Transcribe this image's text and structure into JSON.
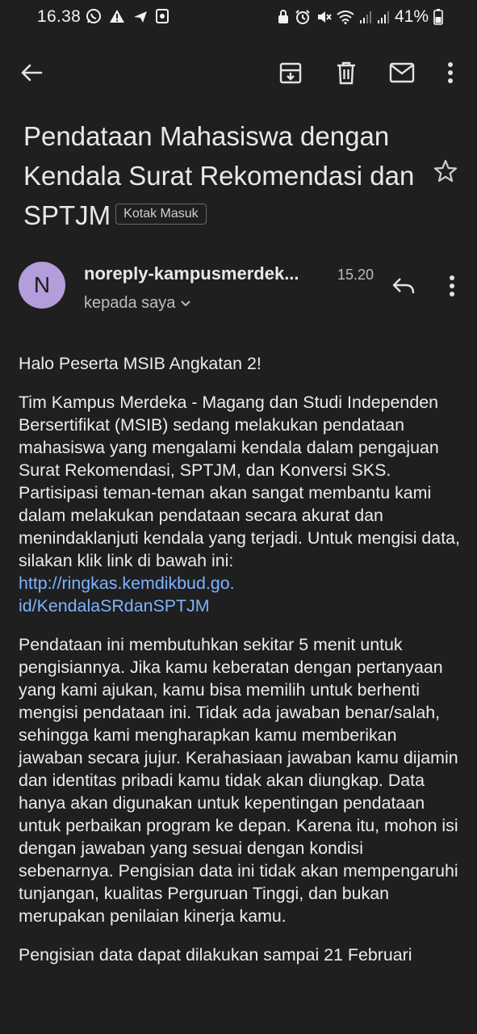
{
  "status_bar": {
    "time": "16.38",
    "battery": "41%",
    "left_icons": [
      "whatsapp-icon",
      "warning-icon",
      "plane-icon",
      "square-notif-icon"
    ],
    "right_icons": [
      "lock-icon",
      "alarm-icon",
      "mute-icon",
      "wifi-icon",
      "signal-icon",
      "signal-icon",
      "battery-icon"
    ]
  },
  "toolbar": {
    "back": "back-arrow-icon",
    "archive": "archive-icon",
    "delete": "trash-icon",
    "mark_unread": "mail-icon",
    "more": "more-vert-icon"
  },
  "email": {
    "subject": "Pendataan Mahasiswa dengan Kendala Surat Rekomendasi dan SPTJM",
    "label": "Kotak Masuk",
    "sender_initial": "N",
    "sender": "noreply-kampusmerdek...",
    "time": "15.20",
    "recipient": "kepada saya",
    "body": {
      "greeting": "Halo Peserta MSIB Angkatan 2!",
      "para1": "Tim Kampus Merdeka - Magang dan Studi Independen Bersertifikat (MSIB) sedang melakukan pendataan mahasiswa yang mengalami kendala dalam pengajuan Surat Rekomendasi, SPTJM, dan Konversi SKS. Partisipasi teman-teman akan sangat membantu kami dalam melakukan pendataan secara akurat dan menindaklanjuti kendala yang terjadi. Untuk mengisi data, silakan klik link di bawah ini:",
      "link_line1": "http://ringkas.kemdikbud.go.",
      "link_line2": "id/KendalaSRdanSPTJM",
      "para2": "Pendataan ini membutuhkan sekitar 5 menit untuk pengisiannya. Jika kamu keberatan dengan pertanyaan yang kami ajukan, kamu bisa memilih untuk berhenti mengisi pendataan ini. Tidak ada jawaban benar/salah, sehingga kami mengharapkan kamu memberikan jawaban secara jujur. Kerahasiaan jawaban kamu dijamin dan identitas pribadi kamu tidak akan diungkap. Data hanya akan digunakan untuk kepentingan pendataan untuk perbaikan program ke depan. Karena itu, mohon isi dengan jawaban yang sesuai dengan kondisi sebenarnya. Pengisian data ini tidak akan mempengaruhi tunjangan, kualitas Perguruan Tinggi, dan bukan merupakan penilaian kinerja kamu.",
      "para3": "Pengisian data dapat dilakukan sampai 21 Februari"
    }
  },
  "colors": {
    "background": "#1f1f1f",
    "avatar": "#b39ddb",
    "link": "#7db3ff"
  }
}
